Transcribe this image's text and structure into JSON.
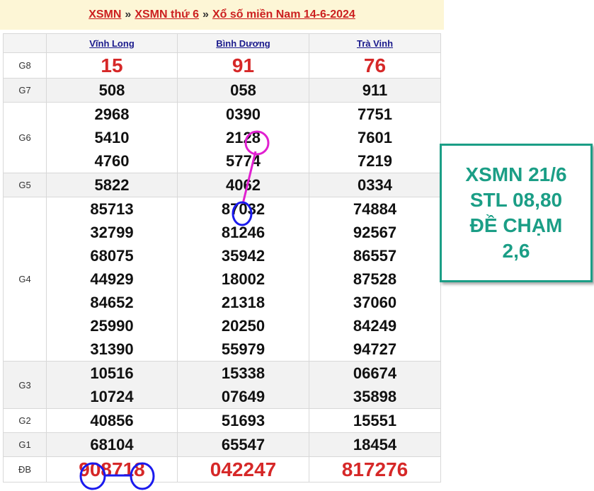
{
  "breadcrumb": {
    "link1": "XSMN",
    "sep1": "»",
    "link2": "XSMN thứ 6",
    "sep2": "»",
    "link3": "Xổ số miền Nam 14-6-2024"
  },
  "table": {
    "columns": [
      "Vĩnh Long",
      "Bình Dương",
      "Trà Vinh"
    ],
    "rows": [
      {
        "label": "G8",
        "values": [
          [
            "15"
          ],
          [
            "91"
          ],
          [
            "76"
          ]
        ]
      },
      {
        "label": "G7",
        "values": [
          [
            "508"
          ],
          [
            "058"
          ],
          [
            "911"
          ]
        ]
      },
      {
        "label": "G6",
        "values": [
          [
            "2968",
            "5410",
            "4760"
          ],
          [
            "0390",
            "2128",
            "5774"
          ],
          [
            "7751",
            "7601",
            "7219"
          ]
        ]
      },
      {
        "label": "G5",
        "values": [
          [
            "5822"
          ],
          [
            "4062"
          ],
          [
            "0334"
          ]
        ]
      },
      {
        "label": "G4",
        "values": [
          [
            "85713",
            "32799",
            "68075",
            "44929",
            "84652",
            "25990",
            "31390"
          ],
          [
            "87032",
            "81246",
            "35942",
            "18002",
            "21318",
            "20250",
            "55979"
          ],
          [
            "74884",
            "92567",
            "86557",
            "87528",
            "37060",
            "84249",
            "94727"
          ]
        ]
      },
      {
        "label": "G3",
        "values": [
          [
            "10516",
            "10724"
          ],
          [
            "15338",
            "07649"
          ],
          [
            "06674",
            "35898"
          ]
        ]
      },
      {
        "label": "G2",
        "values": [
          [
            "40856"
          ],
          [
            "51693"
          ],
          [
            "15551"
          ]
        ]
      },
      {
        "label": "G1",
        "values": [
          [
            "68104"
          ],
          [
            "65547"
          ],
          [
            "18454"
          ]
        ]
      },
      {
        "label": "ĐB",
        "values": [
          [
            "908718"
          ],
          [
            "042247"
          ],
          [
            "817276"
          ]
        ]
      }
    ]
  },
  "callout": {
    "line1": "XSMN 21/6",
    "line2": "STL 08,80",
    "line3": "ĐỀ CHẠM",
    "line4": "2,6"
  },
  "colors": {
    "prize_red": "#d62828",
    "link_blue": "#1a1a8c",
    "callout_teal": "#1b9e86",
    "annot_magenta": "#e020d0",
    "annot_blue": "#1a1aee"
  }
}
